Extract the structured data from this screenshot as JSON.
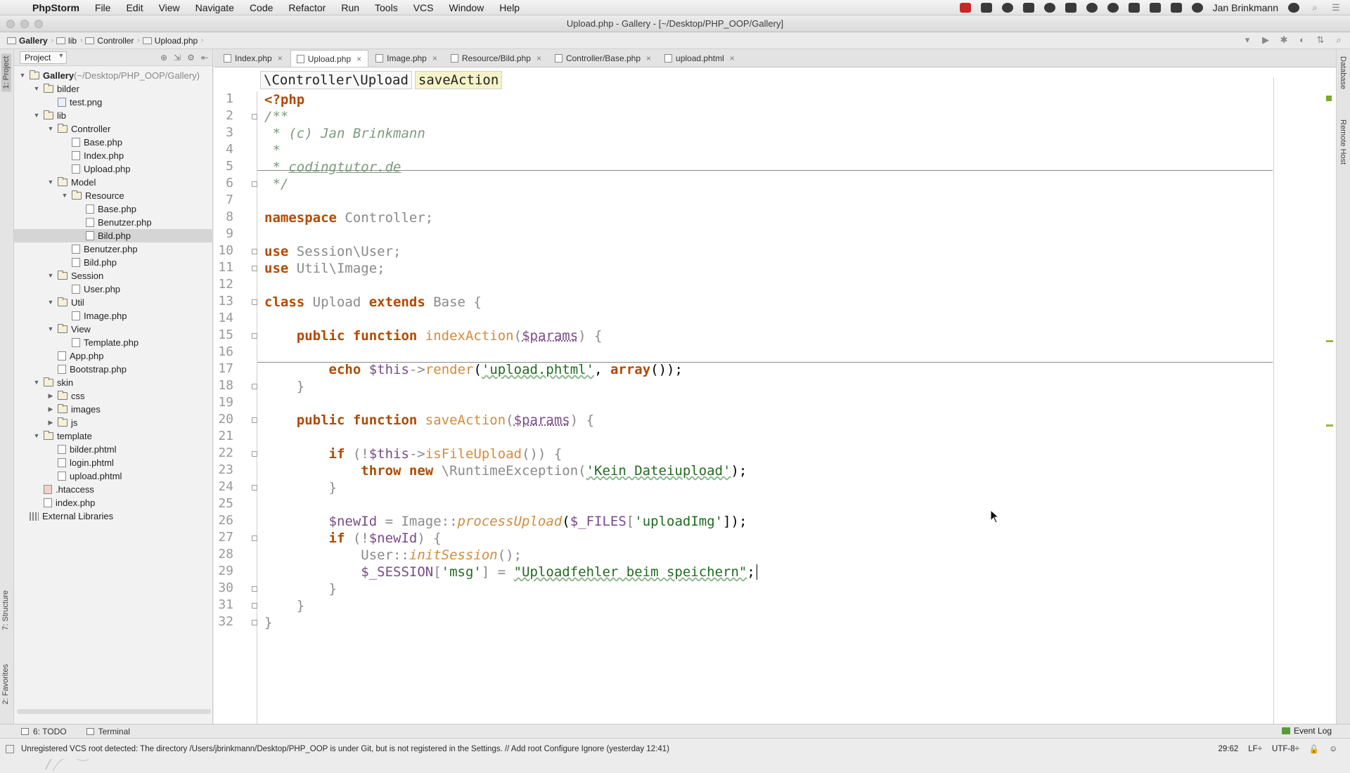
{
  "menubar": {
    "app": "PhpStorm",
    "items": [
      "File",
      "Edit",
      "View",
      "Navigate",
      "Code",
      "Refactor",
      "Run",
      "Tools",
      "VCS",
      "Window",
      "Help"
    ],
    "user": "Jan Brinkmann"
  },
  "window": {
    "title": "Upload.php - Gallery - [~/Desktop/PHP_OOP/Gallery]"
  },
  "breadcrumb": [
    "Gallery",
    "lib",
    "Controller",
    "Upload.php"
  ],
  "sidebar": {
    "left_tabs": [
      "1: Project",
      "7: Structure",
      "2: Favorites"
    ],
    "right_tabs": [
      "Database",
      "Remote Host"
    ]
  },
  "project": {
    "selector": "Project",
    "tree": [
      {
        "name": "Gallery",
        "extra": "(~/Desktop/PHP_OOP/Gallery)",
        "type": "folder",
        "depth": 0,
        "expanded": true
      },
      {
        "name": "bilder",
        "type": "folder",
        "depth": 1,
        "expanded": true
      },
      {
        "name": "test.png",
        "type": "img",
        "depth": 2
      },
      {
        "name": "lib",
        "type": "folder",
        "depth": 1,
        "expanded": true
      },
      {
        "name": "Controller",
        "type": "folder",
        "depth": 2,
        "expanded": true
      },
      {
        "name": "Base.php",
        "type": "php",
        "depth": 3
      },
      {
        "name": "Index.php",
        "type": "php",
        "depth": 3
      },
      {
        "name": "Upload.php",
        "type": "php",
        "depth": 3
      },
      {
        "name": "Model",
        "type": "folder",
        "depth": 2,
        "expanded": true
      },
      {
        "name": "Resource",
        "type": "folder",
        "depth": 3,
        "expanded": true
      },
      {
        "name": "Base.php",
        "type": "php",
        "depth": 4
      },
      {
        "name": "Benutzer.php",
        "type": "php",
        "depth": 4
      },
      {
        "name": "Bild.php",
        "type": "php",
        "depth": 4,
        "selected": true
      },
      {
        "name": "Benutzer.php",
        "type": "php",
        "depth": 3
      },
      {
        "name": "Bild.php",
        "type": "php",
        "depth": 3
      },
      {
        "name": "Session",
        "type": "folder",
        "depth": 2,
        "expanded": true
      },
      {
        "name": "User.php",
        "type": "php",
        "depth": 3
      },
      {
        "name": "Util",
        "type": "folder",
        "depth": 2,
        "expanded": true
      },
      {
        "name": "Image.php",
        "type": "php",
        "depth": 3
      },
      {
        "name": "View",
        "type": "folder",
        "depth": 2,
        "expanded": true
      },
      {
        "name": "Template.php",
        "type": "php",
        "depth": 3
      },
      {
        "name": "App.php",
        "type": "php",
        "depth": 2
      },
      {
        "name": "Bootstrap.php",
        "type": "php",
        "depth": 2
      },
      {
        "name": "skin",
        "type": "folder",
        "depth": 1,
        "expanded": true
      },
      {
        "name": "css",
        "type": "folder",
        "depth": 2,
        "expanded": false
      },
      {
        "name": "images",
        "type": "folder",
        "depth": 2,
        "expanded": false
      },
      {
        "name": "js",
        "type": "folder",
        "depth": 2,
        "expanded": false
      },
      {
        "name": "template",
        "type": "folder",
        "depth": 1,
        "expanded": true
      },
      {
        "name": "bilder.phtml",
        "type": "php",
        "depth": 2
      },
      {
        "name": "login.phtml",
        "type": "php",
        "depth": 2
      },
      {
        "name": "upload.phtml",
        "type": "php",
        "depth": 2
      },
      {
        "name": ".htaccess",
        "type": "ht",
        "depth": 1
      },
      {
        "name": "index.php",
        "type": "php",
        "depth": 1
      },
      {
        "name": "External Libraries",
        "type": "libs",
        "depth": 0
      }
    ]
  },
  "tabs": [
    {
      "label": "Index.php",
      "active": false
    },
    {
      "label": "Upload.php",
      "active": true
    },
    {
      "label": "Image.php",
      "active": false
    },
    {
      "label": "Resource/Bild.php",
      "active": false
    },
    {
      "label": "Controller/Base.php",
      "active": false
    },
    {
      "label": "upload.phtml",
      "active": false
    }
  ],
  "scope": {
    "namespace": "\\Controller\\Upload",
    "method": "saveAction"
  },
  "code": {
    "line_numbers": [
      "1",
      "2",
      "3",
      "4",
      "5",
      "6",
      "7",
      "8",
      "9",
      "10",
      "11",
      "12",
      "13",
      "14",
      "15",
      "16",
      "17",
      "18",
      "19",
      "20",
      "21",
      "22",
      "23",
      "24",
      "25",
      "26",
      "27",
      "28",
      "29",
      "30",
      "31",
      "32"
    ],
    "t1": "<?php",
    "t2": "/**",
    "t3a": " * (c) Jan Brinkmann",
    "t4": " *",
    "t5a": " * ",
    "t5b": "codingtutor.de",
    "t6": " */",
    "t8a": "namespace",
    "t8b": " Controller;",
    "t10a": "use",
    "t10b": " Session\\User;",
    "t11a": "use",
    "t11b": " Util\\Image;",
    "t13a": "class",
    "t13b": " Upload ",
    "t13c": "extends",
    "t13d": " Base {",
    "t15a": "    public function ",
    "t15b": "indexAction",
    "t15c": "(",
    "t15d": "$params",
    "t15e": ") {",
    "t17a": "        echo ",
    "t17b": "$this",
    "t17c": "->",
    "t17d": "render",
    "t17e": "(",
    "t17f": "'upload.phtml'",
    "t17g": ", ",
    "t17h": "array",
    "t17i": "());",
    "t18": "    }",
    "t20a": "    public function ",
    "t20b": "saveAction",
    "t20c": "(",
    "t20d": "$params",
    "t20e": ") {",
    "t22a": "        if ",
    "t22b": "(!",
    "t22c": "$this",
    "t22d": "->",
    "t22e": "isFileUpload",
    "t22f": "()) {",
    "t23a": "            throw new ",
    "t23b": "\\RuntimeException(",
    "t23c": "'Kein Dateiupload'",
    "t23d": ");",
    "t24": "        }",
    "t26a": "        $newId",
    "t26b": " = Image::",
    "t26c": "processUpload",
    "t26d": "(",
    "t26e": "$_FILES",
    "t26f": "[",
    "t26g": "'uploadImg'",
    "t26h": "]);",
    "t27a": "        if ",
    "t27b": "(!",
    "t27c": "$newId",
    "t27d": ") {",
    "t28a": "            User::",
    "t28b": "initSession",
    "t28c": "();",
    "t29a": "            $_SESSION",
    "t29b": "[",
    "t29c": "'msg'",
    "t29d": "] = ",
    "t29e": "\"Uploadfehler beim speichern\"",
    "t29f": ";",
    "t30": "        }",
    "t31": "    }",
    "t32": "}"
  },
  "bottom_tools": {
    "todo": "6: TODO",
    "terminal": "Terminal",
    "event_log": "Event Log"
  },
  "status": {
    "message": "Unregistered VCS root detected: The directory /Users/jbrinkmann/Desktop/PHP_OOP is under Git, but is not registered in the Settings. // Add root  Configure  Ignore (yesterday 12:41)",
    "position": "29:62",
    "line_sep": "LF÷",
    "encoding": "UTF-8÷"
  },
  "colors": {
    "keyword": "#000080",
    "string": "#206b20",
    "function": "#d28c3a",
    "variable": "#7a4a8a",
    "comment": "#7a9a7a"
  }
}
